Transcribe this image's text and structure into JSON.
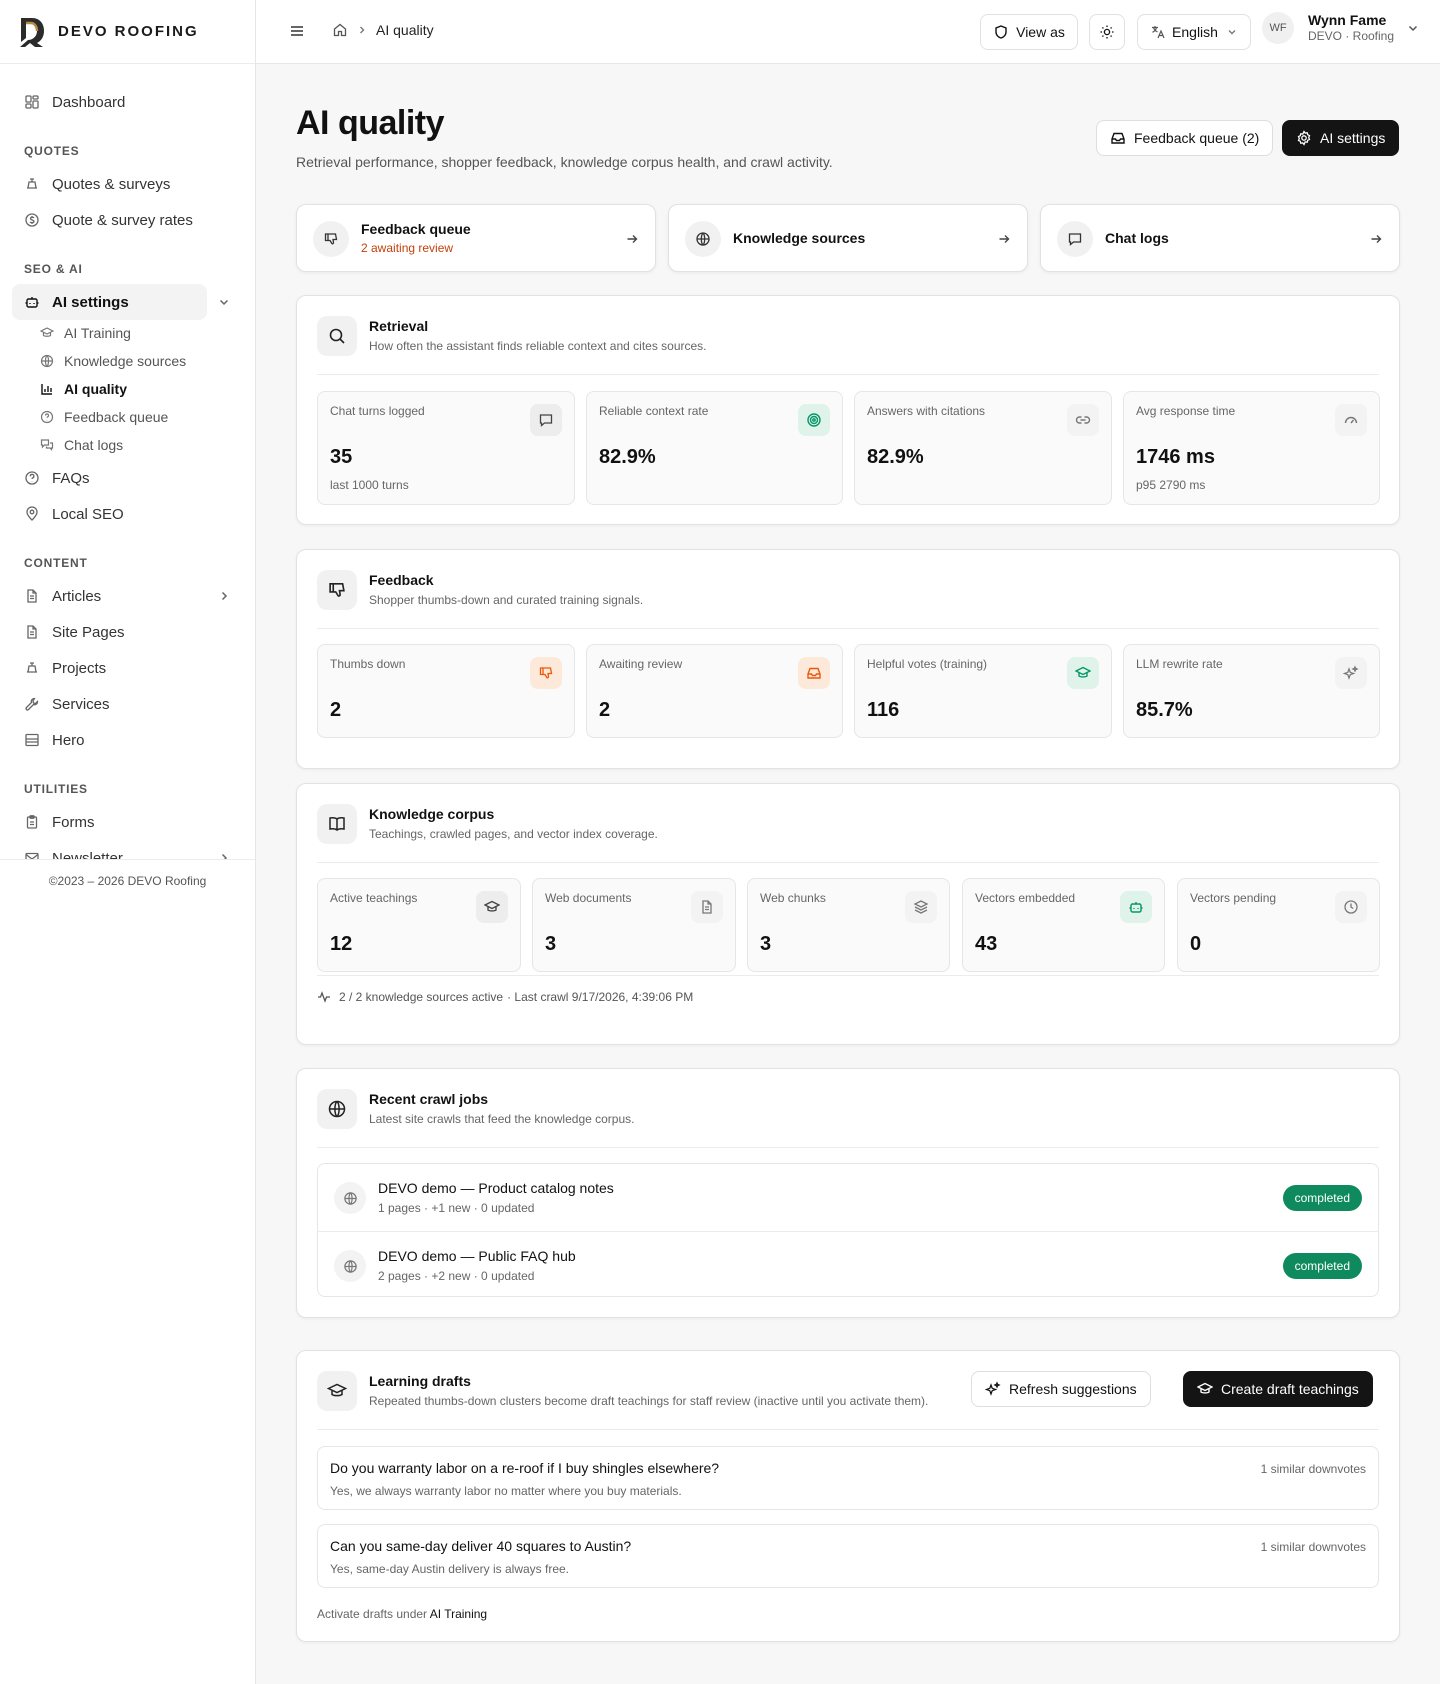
{
  "brand": {
    "name": "DEVO ROOFING"
  },
  "sidebar": {
    "dashboard": "Dashboard",
    "section_quotes": "QUOTES",
    "quotes_surveys": "Quotes & surveys",
    "quote_rates": "Quote & survey rates",
    "section_seo": "SEO & AI",
    "ai_settings": "AI settings",
    "sub_items": [
      "AI Training",
      "Knowledge sources",
      "AI quality",
      "Feedback queue",
      "Chat logs"
    ],
    "faqs": "FAQs",
    "local_seo": "Local SEO",
    "section_content": "CONTENT",
    "articles": "Articles",
    "site_pages": "Site Pages",
    "projects": "Projects",
    "services": "Services",
    "hero": "Hero",
    "section_utilities": "UTILITIES",
    "forms": "Forms",
    "newsletter": "Newsletter",
    "footer": "©2023 – 2026 DEVO Roofing"
  },
  "topbar": {
    "breadcrumb_current": "AI quality",
    "view_as": "View as",
    "language": "English",
    "user_initials": "WF",
    "user_name": "Wynn Fame",
    "user_org": "DEVO · Roofing"
  },
  "page": {
    "title": "AI quality",
    "subtitle": "Retrieval performance, shopper feedback, knowledge corpus health, and crawl activity.",
    "feedback_queue_btn": "Feedback queue (2)",
    "ai_settings_btn": "AI settings"
  },
  "quick_links": [
    {
      "title": "Feedback queue",
      "sub": "2 awaiting review"
    },
    {
      "title": "Knowledge sources"
    },
    {
      "title": "Chat logs"
    }
  ],
  "retrieval": {
    "title": "Retrieval",
    "desc": "How often the assistant finds reliable context and cites sources.",
    "stats": [
      {
        "label": "Chat turns logged",
        "value": "35",
        "note": "last 1000 turns",
        "icon": "message-square-icon"
      },
      {
        "label": "Reliable context rate",
        "value": "82.9%",
        "icon": "target-icon"
      },
      {
        "label": "Answers with citations",
        "value": "82.9%",
        "icon": "link-icon"
      },
      {
        "label": "Avg response time",
        "value": "1746 ms",
        "note": "p95 2790 ms",
        "icon": "gauge-icon"
      }
    ]
  },
  "feedback": {
    "title": "Feedback",
    "desc": "Shopper thumbs-down and curated training signals.",
    "stats": [
      {
        "label": "Thumbs down",
        "value": "2",
        "icon": "thumbs-down-icon"
      },
      {
        "label": "Awaiting review",
        "value": "2",
        "icon": "inbox-icon"
      },
      {
        "label": "Helpful votes (training)",
        "value": "116",
        "icon": "graduation-cap-icon"
      },
      {
        "label": "LLM rewrite rate",
        "value": "85.7%",
        "icon": "sparkles-icon"
      }
    ]
  },
  "corpus": {
    "title": "Knowledge corpus",
    "desc": "Teachings, crawled pages, and vector index coverage.",
    "stats": [
      {
        "label": "Active teachings",
        "value": "12",
        "icon": "graduation-cap-icon"
      },
      {
        "label": "Web documents",
        "value": "3",
        "icon": "file-text-icon"
      },
      {
        "label": "Web chunks",
        "value": "3",
        "icon": "layers-icon"
      },
      {
        "label": "Vectors embedded",
        "value": "43",
        "icon": "bot-icon"
      },
      {
        "label": "Vectors pending",
        "value": "0",
        "icon": "clock-icon"
      }
    ],
    "sources_active": "2 / 2 knowledge sources active",
    "last_crawl": " · Last crawl 9/17/2026, 4:39:06 PM"
  },
  "crawl": {
    "title": "Recent crawl jobs",
    "desc": "Latest site crawls that feed the knowledge corpus.",
    "jobs": [
      {
        "title": "DEVO demo — Product catalog notes",
        "meta": "1 pages · +1 new · 0 updated",
        "status": "completed"
      },
      {
        "title": "DEVO demo — Public FAQ hub",
        "meta": "2 pages · +2 new · 0 updated",
        "status": "completed"
      }
    ]
  },
  "drafts": {
    "title": "Learning drafts",
    "desc": "Repeated thumbs-down clusters become draft teachings for staff review (inactive until you activate them).",
    "refresh_btn": "Refresh suggestions",
    "create_btn": "Create draft teachings",
    "items": [
      {
        "question": "Do you warranty labor on a re-roof if I buy shingles elsewhere?",
        "answer": "Yes, we always warranty labor no matter where you buy materials.",
        "count": "1 similar downvotes"
      },
      {
        "question": "Can you same-day deliver 40 squares to Austin?",
        "answer": "Yes, same-day Austin delivery is always free.",
        "count": "1 similar downvotes"
      }
    ],
    "footer_prefix": "Activate drafts under ",
    "footer_link": "AI Training"
  },
  "colors": {
    "accent_green": "#0f8a5f",
    "warning_orange": "#c2410c",
    "primary_dark": "#141414"
  }
}
